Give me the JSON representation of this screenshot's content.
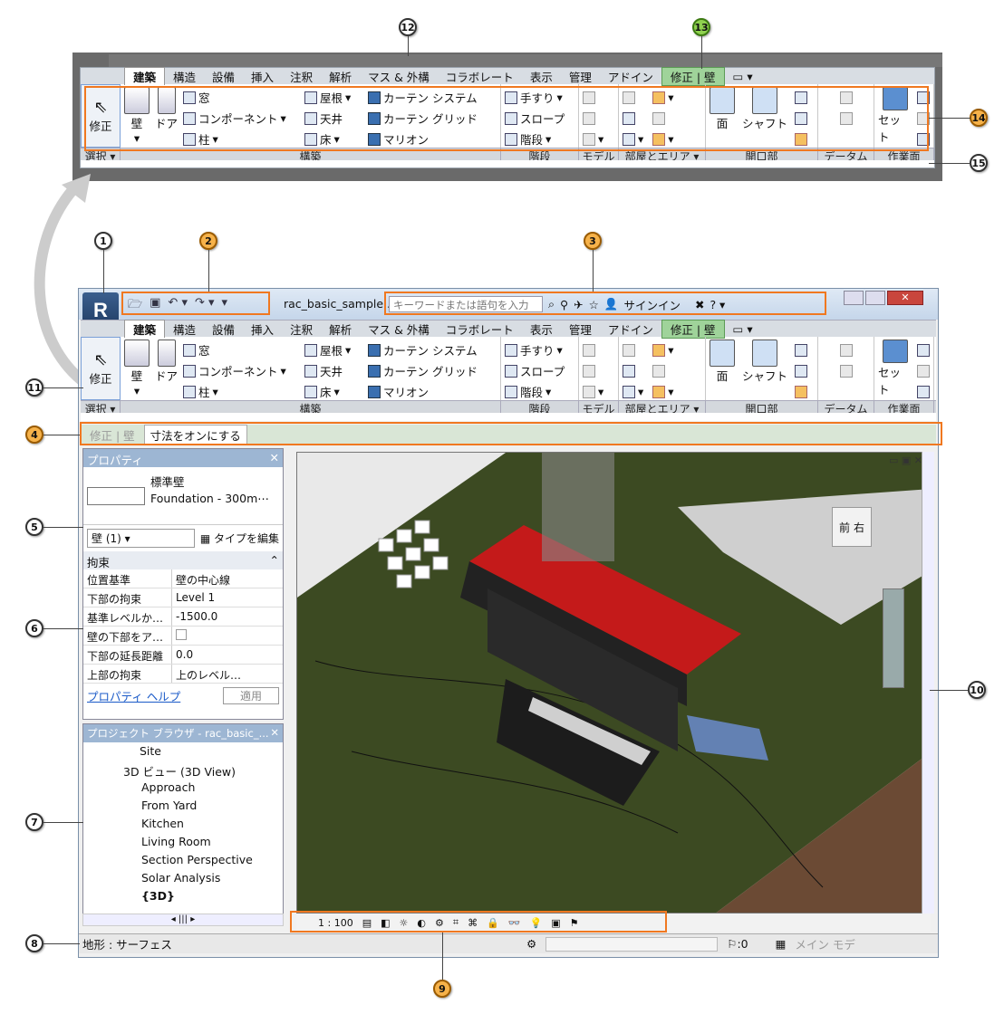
{
  "callouts": [
    "1",
    "2",
    "3",
    "4",
    "5",
    "6",
    "7",
    "8",
    "9",
    "10",
    "11",
    "12",
    "13",
    "14",
    "15"
  ],
  "tabs": [
    "建築",
    "構造",
    "設備",
    "挿入",
    "注釈",
    "解析",
    "マス & 外構",
    "コラボレート",
    "表示",
    "管理",
    "アドイン"
  ],
  "context_tab": "修正 | 壁",
  "ribbon": {
    "modify": "修正",
    "wall": "壁",
    "door": "ドア",
    "window": "窓",
    "component": "コンポーネント",
    "column": "柱",
    "roof": "屋根",
    "ceiling": "天井",
    "floor": "床",
    "curtain_system": "カーテン システム",
    "curtain_grid": "カーテン グリッド",
    "mullion": "マリオン",
    "railing": "手すり",
    "ramp": "スロープ",
    "stair": "階段",
    "face": "面",
    "shaft": "シャフト",
    "set": "セット"
  },
  "panel_bar": {
    "select": "選択 ▾",
    "build": "構築",
    "circulation": "階段",
    "model": "モデル",
    "room": "部屋とエリア ▾",
    "opening": "開口部",
    "datum": "データム",
    "workplane": "作業面"
  },
  "titlebar": {
    "filename": "rac_basic_sample...",
    "search_placeholder": "キーワードまたは語句を入力",
    "signin": "サインイン"
  },
  "options_bar": {
    "context": "修正 | 壁",
    "button": "寸法をオンにする"
  },
  "properties": {
    "header": "プロパティ",
    "type_name": "標準壁",
    "type_sub": "Foundation - 300m⋯",
    "selector": "壁 (1)",
    "edit_type": "タイプを編集",
    "group": "拘束",
    "rows": [
      {
        "k": "位置基準",
        "v": "壁の中心線"
      },
      {
        "k": "下部の拘束",
        "v": "Level 1"
      },
      {
        "k": "基準レベルか…",
        "v": "-1500.0"
      },
      {
        "k": "壁の下部をア…",
        "v": ""
      },
      {
        "k": "下部の延長距離",
        "v": "0.0"
      },
      {
        "k": "上部の拘束",
        "v": "上のレベル…"
      }
    ],
    "help": "プロパティ ヘルプ",
    "apply": "適用"
  },
  "browser": {
    "header": "プロジェクト ブラウザ - rac_basic_...",
    "items": [
      "Site",
      "3D ビュー (3D View)",
      "Approach",
      "From Yard",
      "Kitchen",
      "Living Room",
      "Section Perspective",
      "Solar Analysis",
      "{3D}"
    ]
  },
  "viewcube": {
    "front": "前",
    "right": "右"
  },
  "view_control": {
    "scale": "1 : 100"
  },
  "statusbar": {
    "text": "地形 : サーフェス",
    "filter": ":0",
    "mode": "メイン モデ"
  }
}
